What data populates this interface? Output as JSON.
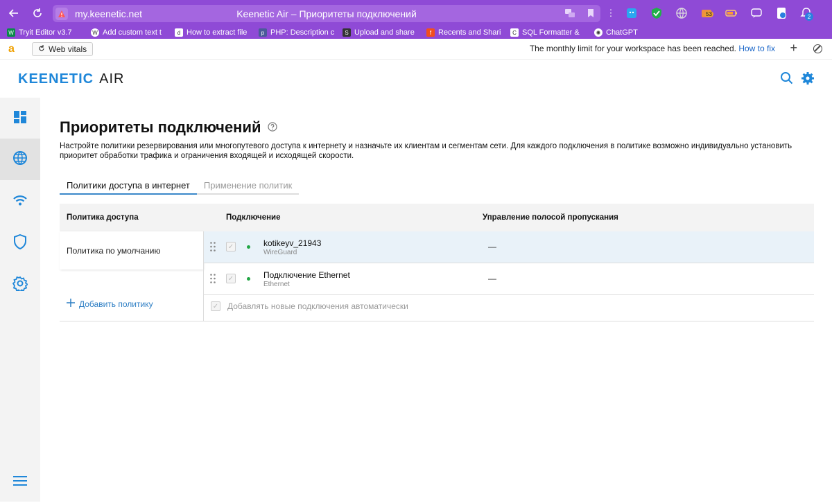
{
  "browser": {
    "url": "my.keenetic.net",
    "page_title": "Keenetic Air – Приоритеты подключений",
    "ext_badge": "53",
    "profile_badge": "2",
    "bookmarks": [
      {
        "label": "Tryit Editor v3.7",
        "icon": "W"
      },
      {
        "label": "Add custom text t",
        "icon": "wp"
      },
      {
        "label": "How to extract file",
        "icon": "djs"
      },
      {
        "label": "PHP: Description c",
        "icon": "php"
      },
      {
        "label": "Upload and share",
        "icon": "SB"
      },
      {
        "label": "Recents and Shari",
        "icon": "figma"
      },
      {
        "label": "SQL Formatter &",
        "icon": "Cb"
      },
      {
        "label": "ChatGPT",
        "icon": "gpt"
      }
    ]
  },
  "extbar": {
    "web_vitals": "Web vitals",
    "notice": "The monthly limit for your workspace has been reached.",
    "notice_link": "How to fix"
  },
  "app": {
    "logo_main": "KEENETIC",
    "logo_sub": "AIR"
  },
  "page": {
    "title": "Приоритеты подключений",
    "description": "Настройте политики резервирования или многопутевого доступа к интернету и назначьте их клиентам и сегментам сети. Для каждого подключения в политике возможно индивидуально установить приоритет обработки трафика и ограничения входящей и исходящей скорости.",
    "tabs": [
      {
        "label": "Политики доступа в интернет",
        "active": true
      },
      {
        "label": "Применение политик",
        "active": false
      }
    ]
  },
  "table": {
    "headers": {
      "policy": "Политика доступа",
      "connection": "Подключение",
      "bandwidth": "Управление полосой пропускания"
    },
    "policies": [
      "Политика по умолчанию"
    ],
    "add_policy": "Добавить политику",
    "connections": [
      {
        "name": "kotikeyv_21943",
        "type": "WireGuard",
        "bandwidth": "—",
        "status": "connected"
      },
      {
        "name": "Подключение Ethernet",
        "type": "Ethernet",
        "bandwidth": "—",
        "status": "connected"
      }
    ],
    "auto_add": "Добавлять новые подключения автоматически"
  },
  "colors": {
    "accent": "#1f87d9",
    "browser": "#8f4ad6",
    "status_ok": "#21a644"
  }
}
